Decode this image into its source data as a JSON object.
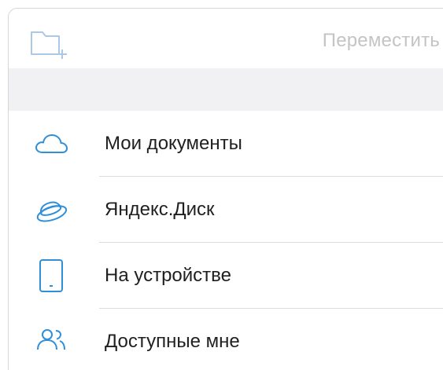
{
  "header": {
    "new_folder_icon": "folder-plus-icon",
    "move_label": "Переместить"
  },
  "locations": [
    {
      "label": "Мои документы",
      "icon": "cloud-icon"
    },
    {
      "label": "Яндекс.Диск",
      "icon": "yandex-disk-icon"
    },
    {
      "label": "На устройстве",
      "icon": "tablet-icon"
    },
    {
      "label": "Доступные мне",
      "icon": "shared-users-icon"
    }
  ],
  "colors": {
    "accent": "#2f8fd8",
    "disabled_text": "#c4c4c4",
    "section_gap": "#f1f1f3"
  }
}
